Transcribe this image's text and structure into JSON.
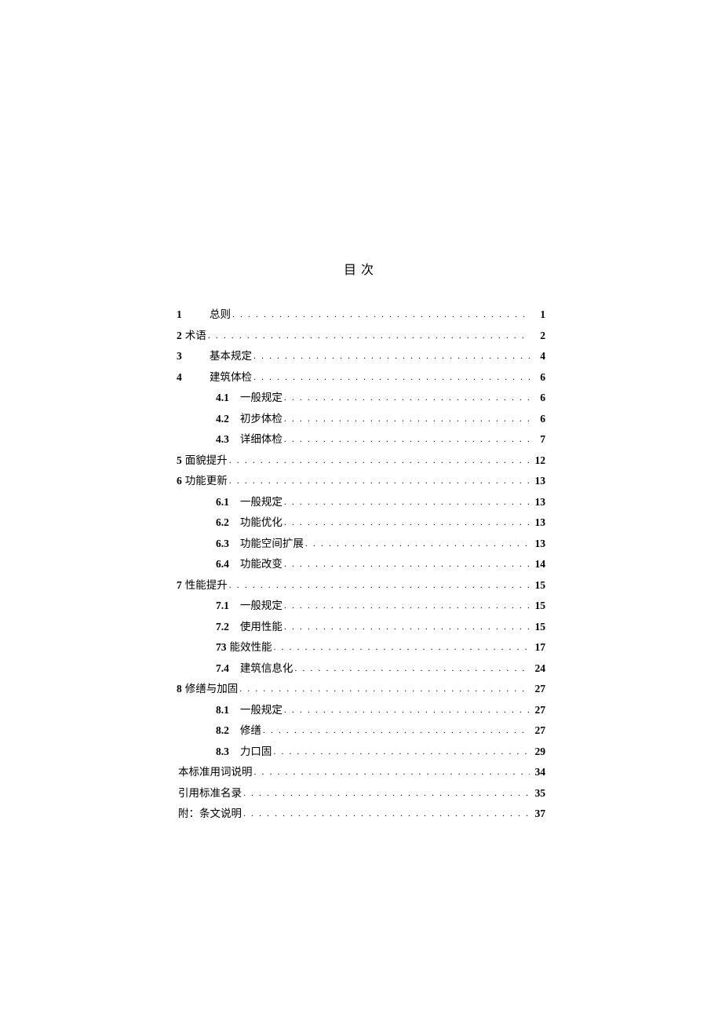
{
  "title": "目次",
  "toc": [
    {
      "num": "1",
      "label": "总则",
      "page": "1",
      "indent": 0,
      "numGap": true
    },
    {
      "num": "2",
      "label": "术语",
      "page": "2",
      "indent": 0,
      "numGap": false
    },
    {
      "num": "3",
      "label": "基本规定",
      "page": "4",
      "indent": 0,
      "numGap": true
    },
    {
      "num": "4",
      "label": "建筑体检",
      "page": "6",
      "indent": 0,
      "numGap": true
    },
    {
      "num": "4.1",
      "label": "一般规定",
      "page": "6",
      "indent": 1
    },
    {
      "num": "4.2",
      "label": "初步体检",
      "page": "6",
      "indent": 1
    },
    {
      "num": "4.3",
      "label": "详细体检",
      "page": "7",
      "indent": 1
    },
    {
      "num": "5",
      "label": "面貌提升",
      "page": "12",
      "indent": 0,
      "numGap": false
    },
    {
      "num": "6",
      "label": "功能更新",
      "page": "13",
      "indent": 0,
      "numGap": false
    },
    {
      "num": "6.1",
      "label": "一般规定",
      "page": "13",
      "indent": 1
    },
    {
      "num": "6.2",
      "label": "功能优化",
      "page": "13",
      "indent": 1
    },
    {
      "num": "6.3",
      "label": "功能空间扩展",
      "page": "13",
      "indent": 1
    },
    {
      "num": "6.4",
      "label": "功能改变",
      "page": "14",
      "indent": 1
    },
    {
      "num": "7",
      "label": "性能提升",
      "page": "15",
      "indent": 0,
      "numGap": false
    },
    {
      "num": "7.1",
      "label": "一般规定",
      "page": "15",
      "indent": 1
    },
    {
      "num": "7.2",
      "label": "使用性能",
      "page": "15",
      "indent": 1
    },
    {
      "num": "73",
      "label": "能效性能",
      "page": "17",
      "indent": 1,
      "noSubGap": true
    },
    {
      "num": "7.4",
      "label": "建筑信息化",
      "page": "24",
      "indent": 1
    },
    {
      "num": "8",
      "label": "修缮与加固",
      "page": "27",
      "indent": 0,
      "numGap": false
    },
    {
      "num": "8.1",
      "label": "一般规定",
      "page": "27",
      "indent": 1
    },
    {
      "num": "8.2",
      "label": "修缮",
      "page": "27",
      "indent": 1
    },
    {
      "num": "8.3",
      "label": "力口固",
      "page": "29",
      "indent": 1
    },
    {
      "num": "",
      "label": "本标准用词说明",
      "page": "34",
      "indent": 0,
      "noNum": true
    },
    {
      "num": "",
      "label": "引用标准名录",
      "page": "35",
      "indent": 0,
      "noNum": true
    },
    {
      "num": "",
      "label": "附：条文说明",
      "page": "37",
      "indent": 0,
      "noNum": true
    }
  ]
}
